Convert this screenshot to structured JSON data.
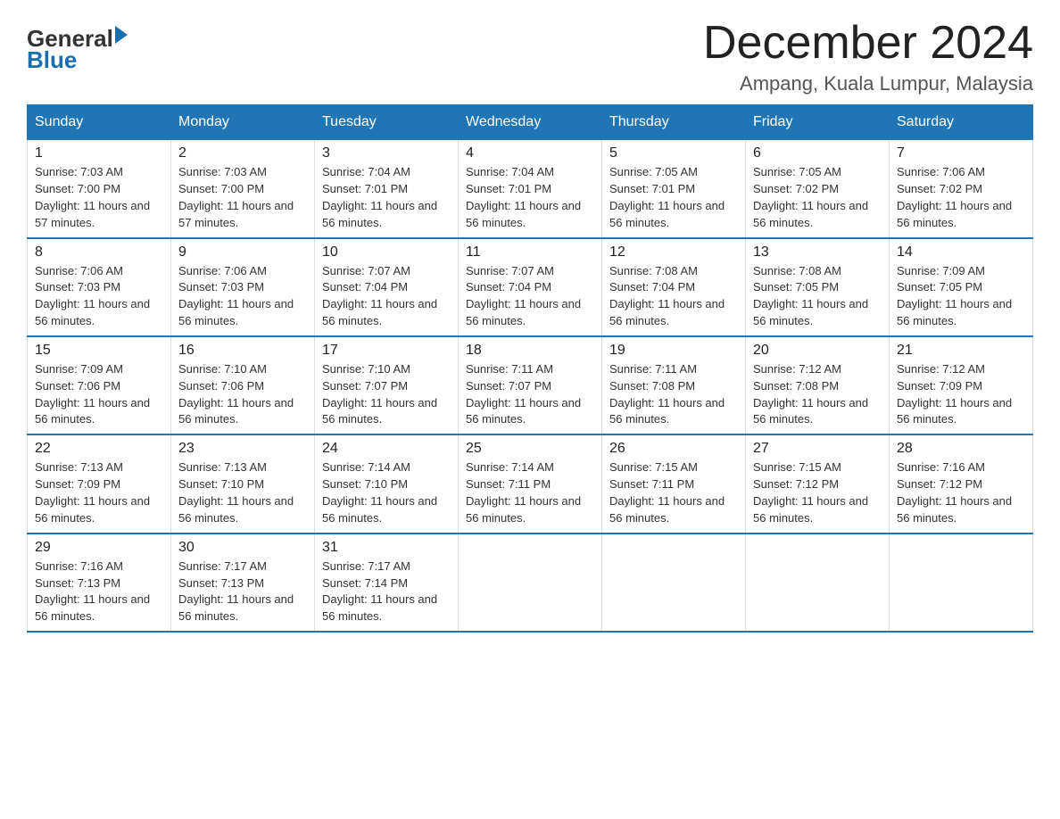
{
  "header": {
    "logo_general": "General",
    "logo_blue": "Blue",
    "month_title": "December 2024",
    "location": "Ampang, Kuala Lumpur, Malaysia"
  },
  "days_of_week": [
    "Sunday",
    "Monday",
    "Tuesday",
    "Wednesday",
    "Thursday",
    "Friday",
    "Saturday"
  ],
  "weeks": [
    [
      {
        "day": "1",
        "sunrise": "7:03 AM",
        "sunset": "7:00 PM",
        "daylight": "11 hours and 57 minutes."
      },
      {
        "day": "2",
        "sunrise": "7:03 AM",
        "sunset": "7:00 PM",
        "daylight": "11 hours and 57 minutes."
      },
      {
        "day": "3",
        "sunrise": "7:04 AM",
        "sunset": "7:01 PM",
        "daylight": "11 hours and 56 minutes."
      },
      {
        "day": "4",
        "sunrise": "7:04 AM",
        "sunset": "7:01 PM",
        "daylight": "11 hours and 56 minutes."
      },
      {
        "day": "5",
        "sunrise": "7:05 AM",
        "sunset": "7:01 PM",
        "daylight": "11 hours and 56 minutes."
      },
      {
        "day": "6",
        "sunrise": "7:05 AM",
        "sunset": "7:02 PM",
        "daylight": "11 hours and 56 minutes."
      },
      {
        "day": "7",
        "sunrise": "7:06 AM",
        "sunset": "7:02 PM",
        "daylight": "11 hours and 56 minutes."
      }
    ],
    [
      {
        "day": "8",
        "sunrise": "7:06 AM",
        "sunset": "7:03 PM",
        "daylight": "11 hours and 56 minutes."
      },
      {
        "day": "9",
        "sunrise": "7:06 AM",
        "sunset": "7:03 PM",
        "daylight": "11 hours and 56 minutes."
      },
      {
        "day": "10",
        "sunrise": "7:07 AM",
        "sunset": "7:04 PM",
        "daylight": "11 hours and 56 minutes."
      },
      {
        "day": "11",
        "sunrise": "7:07 AM",
        "sunset": "7:04 PM",
        "daylight": "11 hours and 56 minutes."
      },
      {
        "day": "12",
        "sunrise": "7:08 AM",
        "sunset": "7:04 PM",
        "daylight": "11 hours and 56 minutes."
      },
      {
        "day": "13",
        "sunrise": "7:08 AM",
        "sunset": "7:05 PM",
        "daylight": "11 hours and 56 minutes."
      },
      {
        "day": "14",
        "sunrise": "7:09 AM",
        "sunset": "7:05 PM",
        "daylight": "11 hours and 56 minutes."
      }
    ],
    [
      {
        "day": "15",
        "sunrise": "7:09 AM",
        "sunset": "7:06 PM",
        "daylight": "11 hours and 56 minutes."
      },
      {
        "day": "16",
        "sunrise": "7:10 AM",
        "sunset": "7:06 PM",
        "daylight": "11 hours and 56 minutes."
      },
      {
        "day": "17",
        "sunrise": "7:10 AM",
        "sunset": "7:07 PM",
        "daylight": "11 hours and 56 minutes."
      },
      {
        "day": "18",
        "sunrise": "7:11 AM",
        "sunset": "7:07 PM",
        "daylight": "11 hours and 56 minutes."
      },
      {
        "day": "19",
        "sunrise": "7:11 AM",
        "sunset": "7:08 PM",
        "daylight": "11 hours and 56 minutes."
      },
      {
        "day": "20",
        "sunrise": "7:12 AM",
        "sunset": "7:08 PM",
        "daylight": "11 hours and 56 minutes."
      },
      {
        "day": "21",
        "sunrise": "7:12 AM",
        "sunset": "7:09 PM",
        "daylight": "11 hours and 56 minutes."
      }
    ],
    [
      {
        "day": "22",
        "sunrise": "7:13 AM",
        "sunset": "7:09 PM",
        "daylight": "11 hours and 56 minutes."
      },
      {
        "day": "23",
        "sunrise": "7:13 AM",
        "sunset": "7:10 PM",
        "daylight": "11 hours and 56 minutes."
      },
      {
        "day": "24",
        "sunrise": "7:14 AM",
        "sunset": "7:10 PM",
        "daylight": "11 hours and 56 minutes."
      },
      {
        "day": "25",
        "sunrise": "7:14 AM",
        "sunset": "7:11 PM",
        "daylight": "11 hours and 56 minutes."
      },
      {
        "day": "26",
        "sunrise": "7:15 AM",
        "sunset": "7:11 PM",
        "daylight": "11 hours and 56 minutes."
      },
      {
        "day": "27",
        "sunrise": "7:15 AM",
        "sunset": "7:12 PM",
        "daylight": "11 hours and 56 minutes."
      },
      {
        "day": "28",
        "sunrise": "7:16 AM",
        "sunset": "7:12 PM",
        "daylight": "11 hours and 56 minutes."
      }
    ],
    [
      {
        "day": "29",
        "sunrise": "7:16 AM",
        "sunset": "7:13 PM",
        "daylight": "11 hours and 56 minutes."
      },
      {
        "day": "30",
        "sunrise": "7:17 AM",
        "sunset": "7:13 PM",
        "daylight": "11 hours and 56 minutes."
      },
      {
        "day": "31",
        "sunrise": "7:17 AM",
        "sunset": "7:14 PM",
        "daylight": "11 hours and 56 minutes."
      },
      null,
      null,
      null,
      null
    ]
  ],
  "labels": {
    "sunrise": "Sunrise:",
    "sunset": "Sunset:",
    "daylight": "Daylight:"
  }
}
